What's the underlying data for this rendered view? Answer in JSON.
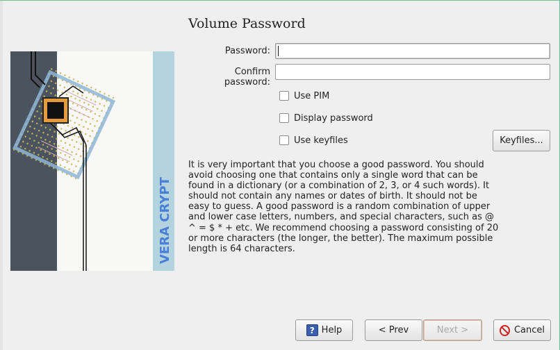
{
  "page": {
    "title": "Volume Password"
  },
  "form": {
    "password_label": "Password:",
    "password_value": "",
    "confirm_label": "Confirm password:",
    "confirm_value": ""
  },
  "options": {
    "use_pim_label": "Use PIM",
    "use_pim_checked": false,
    "display_password_label": "Display password",
    "display_password_checked": false,
    "use_keyfiles_label": "Use keyfiles",
    "use_keyfiles_checked": false,
    "keyfiles_button": "Keyfiles..."
  },
  "info_text": "It is very important that you choose a good password. You should avoid choosing one that contains only a single word that can be found in a dictionary (or a combination of 2, 3, or 4 such words). It should not contain any names or dates of birth. It should not be easy to guess. A good password is a random combination of upper and lower case letters, numbers, and special characters, such as @ ^ = $ * + etc. We recommend choosing a password consisting of 20 or more characters (the longer, the better). The maximum possible length is 64 characters.",
  "banner": {
    "brand_text": "VERA CRYPT"
  },
  "footer": {
    "help_label": "Help",
    "help_icon": "help-icon",
    "prev_label": "< Prev",
    "next_label": "Next >",
    "next_enabled": false,
    "cancel_label": "Cancel",
    "cancel_icon": "cancel-icon"
  },
  "colors": {
    "brand_blue": "#4a7fd8",
    "banner_dark": "#4a535d",
    "banner_light_blue": "#b2d3e0",
    "chip_orange": "#e59a3c",
    "cancel_red": "#d0211f"
  }
}
